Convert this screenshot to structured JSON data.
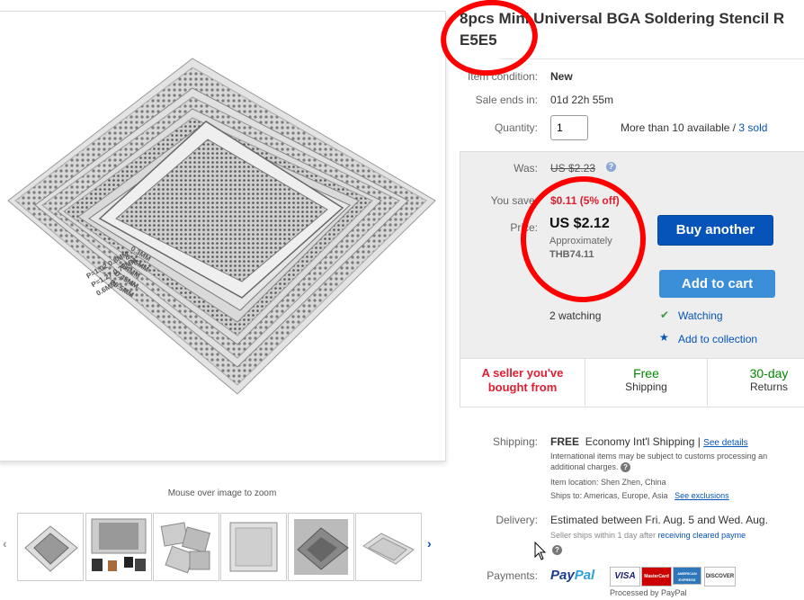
{
  "product": {
    "title_line1": "8pcs Mini Universal BGA Soldering Stencil R",
    "title_line2": "E5E5",
    "stencil_labels": [
      "0.3MM",
      "0.35MM",
      "0.4MM",
      "0.45MM",
      "P0.5MM",
      "0.6MM",
      "P=1.27",
      "0.76MM",
      "P=1.02",
      "0.8MM"
    ]
  },
  "details": {
    "condition_label": "Item condition:",
    "condition_value": "New",
    "sale_label": "Sale ends in:",
    "sale_value": "01d 22h 55m",
    "quantity_label": "Quantity:",
    "quantity_value": "1",
    "availability": "More than 10 available / ",
    "sold": "3 sold"
  },
  "pricing": {
    "was_label": "Was:",
    "was_value": "US $2.23",
    "help_icon": "question-icon",
    "save_label": "You save:",
    "save_value": "$0.11 (5% off)",
    "price_label": "Price:",
    "price_value": "US $2.12",
    "approx_label": "Approximately",
    "approx_value": "THB74.11",
    "watching": "2 watching",
    "buy_button": "Buy another",
    "cart_button": "Add to cart",
    "watching_link": "Watching",
    "collection_link": "Add to collection"
  },
  "features": {
    "seller_line1": "A seller you've",
    "seller_line2": "bought from",
    "free_top": "Free",
    "free_bottom": "Shipping",
    "returns_top": "30-day",
    "returns_bottom": "Returns"
  },
  "shipping": {
    "label": "Shipping:",
    "free": "FREE",
    "method": "Economy Int'l Shipping | ",
    "details_link": "See details",
    "note_line1": "International items may be subject to customs processing an",
    "note_line2": "additional charges.",
    "location": "Item location:  Shen Zhen, China",
    "ships_to": "Ships to:  Americas, Europe, Asia",
    "exclusions_link": "See exclusions"
  },
  "delivery": {
    "label": "Delivery:",
    "estimate": "Estimated between Fri. Aug. 5 and Wed. Aug.",
    "note": "Seller ships within 1 day after ",
    "note_link": "receiving cleared payme"
  },
  "payments": {
    "label": "Payments:",
    "paypal_pay": "Pay",
    "paypal_pal": "Pal",
    "cards": [
      "VISA",
      "MasterCard",
      "AMERICAN EXPRESS",
      "DISCOVER"
    ],
    "processed": "Processed by PayPal"
  },
  "gallery": {
    "zoom_hint": "Mouse over image to zoom",
    "prev_icon": "‹",
    "next_icon": "›"
  },
  "colors": {
    "accent_blue": "#0654ba",
    "cart_blue": "#3b8fd9",
    "discount_red": "#dd1e31",
    "annotation_red": "#ff0000",
    "free_green": "#008a00"
  }
}
